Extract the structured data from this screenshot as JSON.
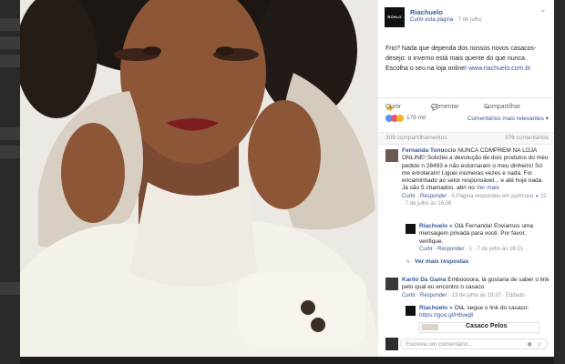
{
  "post": {
    "page_name": "Riachuelo",
    "logo_text": "RCHLO",
    "follow_label": "Curtir esta página",
    "date": "7 de julho",
    "text": "Frio? Nada que dependa dos nossos novos casacos-desejo: o inverno está mais quente do que nunca. Escolha o seu na loja online!",
    "link": "www.riachuelo.com.br"
  },
  "actions": {
    "like": "Curtir",
    "comment": "Comentar",
    "share": "Compartilhar"
  },
  "reactions": {
    "count": "176 mil",
    "sort_label": "Comentários mais relevantes",
    "shares": "309 compartilhamentos",
    "comments_count": "376 comentários",
    "colors": {
      "like": "#5890ff",
      "love": "#f25268",
      "haha": "#f7b125"
    }
  },
  "comments": [
    {
      "author": "Fernanda Tonuccio",
      "text": "NUNCA COMPREM NA LOJA ONLINE! Solicitei a devolução de dois produtos do meu pedido n 28493 e não estornaram o meu dinheiro! Só me enrolaram! Liguei inúmeras vezes e nada. Foi encaminhado ao setor responsável... e até hoje nada. Já são 5 chamados, abri no",
      "see_more": "Ver mais",
      "reply": "Curtir · Responder",
      "meta": "A Página respondeu em particular",
      "reactions": "22",
      "time": "7 de julho às 16:08"
    },
    {
      "author": "Riachuelo",
      "text": "Olá Fernanda! Enviamos uma mensagem privada para você. Por favor, verifique.",
      "reply": "Curtir · Responder",
      "reactions": "1",
      "time": "7 de julho às 16:21"
    }
  ],
  "more_replies": "Ver mais respostas",
  "comment2": {
    "author": "Karilo Da Gama",
    "text": "Emboooora, lá gostaria de saber o link pelo qual eu encontro o casaco",
    "reply": "Curtir · Responder",
    "time": "13 de julho às 19:20 · Editado"
  },
  "reply2": {
    "author": "Riachuelo",
    "text": "Olá, segue o link do casaco:",
    "url": "https://goo.gl/Hbwq8",
    "card_title": "Casaco Pelos"
  },
  "compose": {
    "placeholder": "Escreva um comentário..."
  }
}
